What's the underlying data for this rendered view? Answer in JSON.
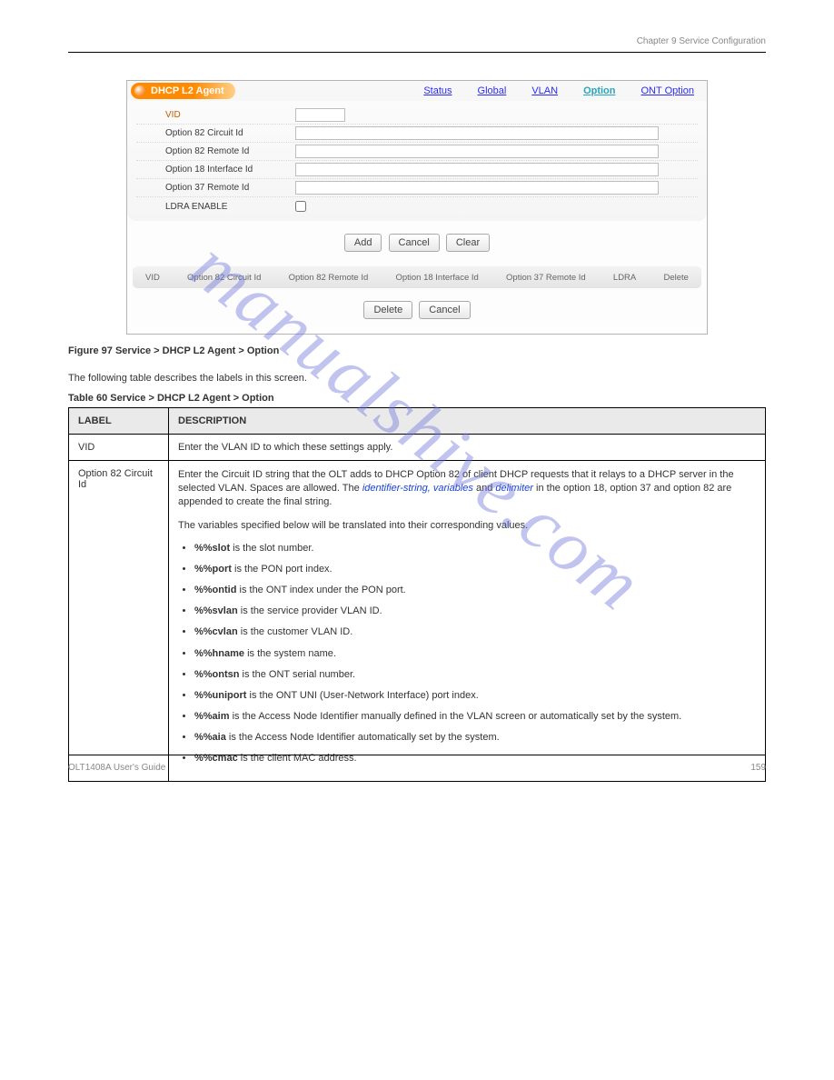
{
  "header": {
    "left": " ",
    "right": "Chapter 9 Service Configuration"
  },
  "footer": {
    "left": "OLT1408A User's Guide",
    "right": "159"
  },
  "watermark": "manualshive.com",
  "panel": {
    "title": "DHCP L2 Agent",
    "nav": {
      "status": "Status",
      "global": "Global",
      "vlan": "VLAN",
      "option": "Option",
      "ont_option": "ONT Option"
    },
    "form": {
      "vid_label": "VID",
      "opt82_circuit_label": "Option 82 Circuit Id",
      "opt82_remote_label": "Option 82 Remote Id",
      "opt18_interface_label": "Option 18 Interface Id",
      "opt37_remote_label": "Option 37 Remote Id",
      "ldra_label": "LDRA ENABLE"
    },
    "buttons_top": {
      "add": "Add",
      "cancel": "Cancel",
      "clear": "Clear"
    },
    "col_headers": {
      "vid": "VID",
      "c82c": "Option 82 Circuit Id",
      "c82r": "Option 82 Remote Id",
      "c18i": "Option 18 Interface Id",
      "c37r": "Option 37 Remote Id",
      "ldra": "LDRA",
      "del": "Delete"
    },
    "buttons_bottom": {
      "delete": "Delete",
      "cancel": "Cancel"
    }
  },
  "figure_caption": {
    "prefix": "Figure 97   ",
    "rest": "Service > DHCP L2 Agent > Option"
  },
  "explain_line": "The following table describes the labels in this screen.",
  "table_caption": {
    "prefix": "Table 60   ",
    "rest": "Service > DHCP L2 Agent > Option"
  },
  "desc_table": {
    "head_label": "LABEL",
    "head_desc": "DESCRIPTION",
    "rows": [
      {
        "label": "VID",
        "desc_plain": "Enter the VLAN ID to which these settings apply."
      },
      {
        "label": "Option 82 Circuit Id",
        "desc": {
          "p1_a": "Enter the Circuit ID string that the OLT adds to DHCP Option 82 of client DHCP requests that it relays to a DHCP server in the selected VLAN. Spaces are allowed. The ",
          "p1_var": "identifier-string, variables",
          "p1_b": " and ",
          "p1_var2": "delimiter",
          "p1_c": " in the option 18, option 37 and option 82 are appended to create the final string.",
          "p2": "The variables specified below will be translated into their corresponding values. ",
          "bullets": [
            {
              "b": "%%slot",
              "t": " is the slot number."
            },
            {
              "b": "%%port",
              "t": " is the PON port index."
            },
            {
              "b": "%%ontid",
              "t": " is the ONT index under the PON port."
            },
            {
              "b": "%%svlan",
              "t": " is the service provider VLAN ID."
            },
            {
              "b": "%%cvlan",
              "t": " is the customer VLAN ID."
            },
            {
              "b": "%%hname",
              "t": " is the system name."
            },
            {
              "b": "%%ontsn",
              "t": " is the ONT serial number."
            },
            {
              "b": "%%uniport",
              "t": " is the ONT UNI (User-Network Interface) port index."
            },
            {
              "b": "%%aim",
              "t": " is the Access Node Identifier manually defined in the VLAN screen or automatically set by the system."
            },
            {
              "b": "%%aia",
              "t": " is the Access Node Identifier automatically set by the system."
            },
            {
              "b": "%%cmac",
              "t": " is the client MAC address."
            }
          ]
        }
      }
    ]
  }
}
